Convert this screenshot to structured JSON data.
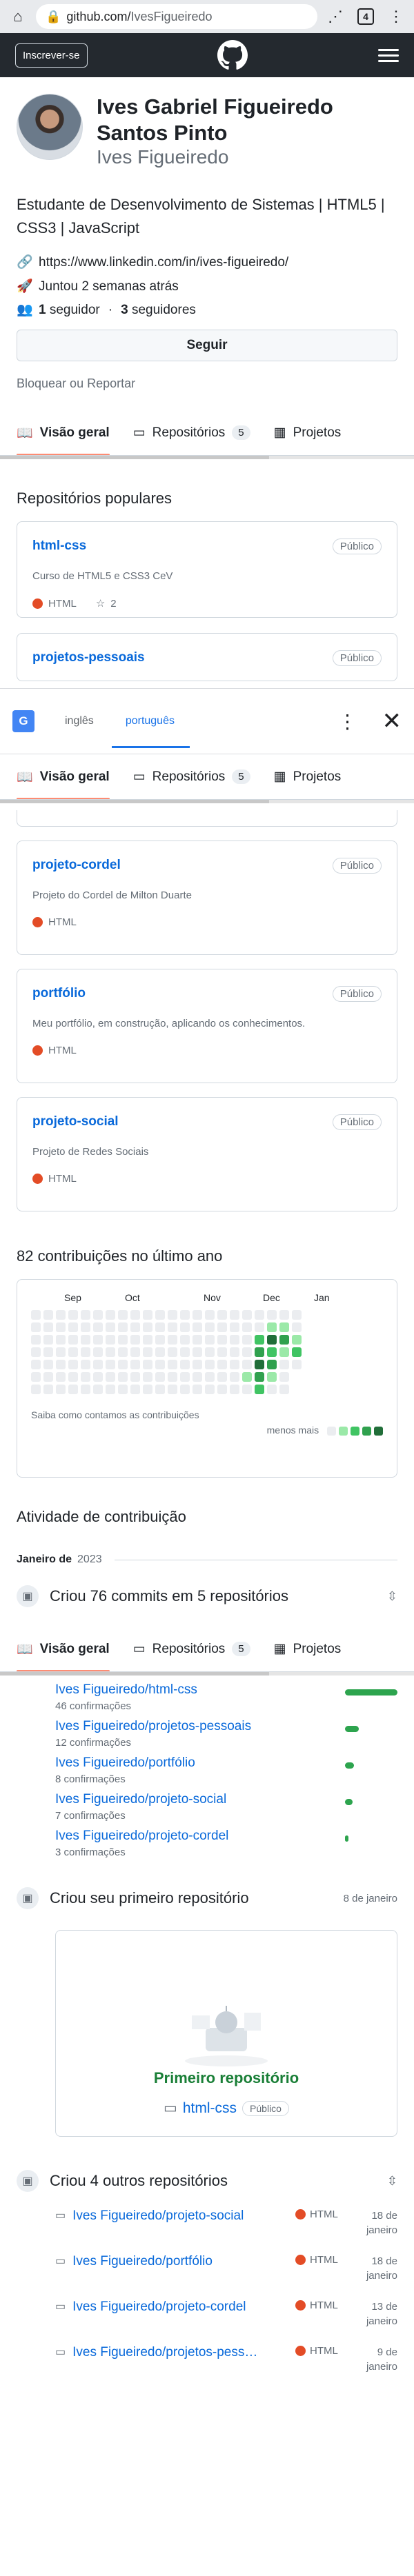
{
  "browser": {
    "url_host": "github.com/",
    "url_path": "IvesFigueiredo",
    "tab_count": "4"
  },
  "header": {
    "signup_label": "Inscrever-se"
  },
  "profile": {
    "name": "Ives Gabriel Figueiredo Santos Pinto",
    "login": "Ives Figueiredo",
    "bio": "Estudante de Desenvolvimento de Sistemas | HTML5 | CSS3 | JavaScript",
    "website": "https://www.linkedin.com/in/ives-figueiredo/",
    "joined": "Juntou 2 semanas atrás",
    "followers_count": "1",
    "followers_label": "seguidor",
    "following_count": "3",
    "following_label": "seguidores",
    "follow_label": "Seguir",
    "block_label": "Bloquear ou Reportar"
  },
  "tabs": [
    {
      "label": "Visão geral"
    },
    {
      "label": "Repositórios",
      "count": "5"
    },
    {
      "label": "Projetos"
    }
  ],
  "popular_title": "Repositórios populares",
  "public_label": "Público",
  "repos": [
    {
      "name": "html-css",
      "desc": "Curso de HTML5 e CSS3 CeV",
      "lang": "HTML",
      "stars": "2"
    },
    {
      "name": "projetos-pessoais",
      "desc": "",
      "lang": "HTML"
    },
    {
      "name": "projeto-cordel",
      "desc": "Projeto do Cordel de Milton Duarte",
      "lang": "HTML"
    },
    {
      "name": "portfólio",
      "desc": "Meu portfólio, em construção, aplicando os conhecimentos.",
      "lang": "HTML"
    },
    {
      "name": "projeto-social",
      "desc": "Projeto de Redes Sociais",
      "lang": "HTML"
    }
  ],
  "translate": {
    "source": "inglês",
    "target": "português"
  },
  "contributions": {
    "title": "82 contribuições no último ano",
    "months": [
      "Sep",
      "Oct",
      "Nov",
      "Dec",
      "Jan"
    ],
    "footer_link": "Saiba como contamos as contribuições",
    "less": "menos",
    "more": "mais",
    "level_colors": [
      "#ebedf0",
      "#9be9a8",
      "#40c463",
      "#30a14e",
      "#216e39"
    ]
  },
  "activity": {
    "title": "Atividade de contribuição",
    "month": "Janeiro de",
    "year": "2023",
    "commits_event": "Criou 76 commits em 5 repositórios",
    "commit_rows": [
      {
        "repo": "Ives Figueiredo/html-css",
        "count": "46 confirmações"
      },
      {
        "repo": "Ives Figueiredo/projetos-pessoais",
        "count": "12 confirmações"
      },
      {
        "repo": "Ives Figueiredo/portfólio",
        "count": "8 confirmações"
      },
      {
        "repo": "Ives Figueiredo/projeto-social",
        "count": "7 confirmações"
      },
      {
        "repo": "Ives Figueiredo/projeto-cordel",
        "count": "3 confirmações"
      }
    ],
    "first_repo_event": "Criou seu primeiro repositório",
    "first_repo_date": "8 de janeiro",
    "first_repo_title": "Primeiro repositório",
    "first_repo_name": "html-css",
    "other_repos_event": "Criou 4 outros repositórios",
    "other_repos": [
      {
        "repo": "Ives Figueiredo/projeto-social",
        "lang": "HTML",
        "date": "18 de janeiro"
      },
      {
        "repo": "Ives Figueiredo/portfólio",
        "lang": "HTML",
        "date": "18 de janeiro"
      },
      {
        "repo": "Ives Figueiredo/projeto-cordel",
        "lang": "HTML",
        "date": "13 de janeiro"
      },
      {
        "repo": "Ives Figueiredo/projetos-pess…",
        "lang": "HTML",
        "date": "9 de janeiro"
      }
    ]
  }
}
